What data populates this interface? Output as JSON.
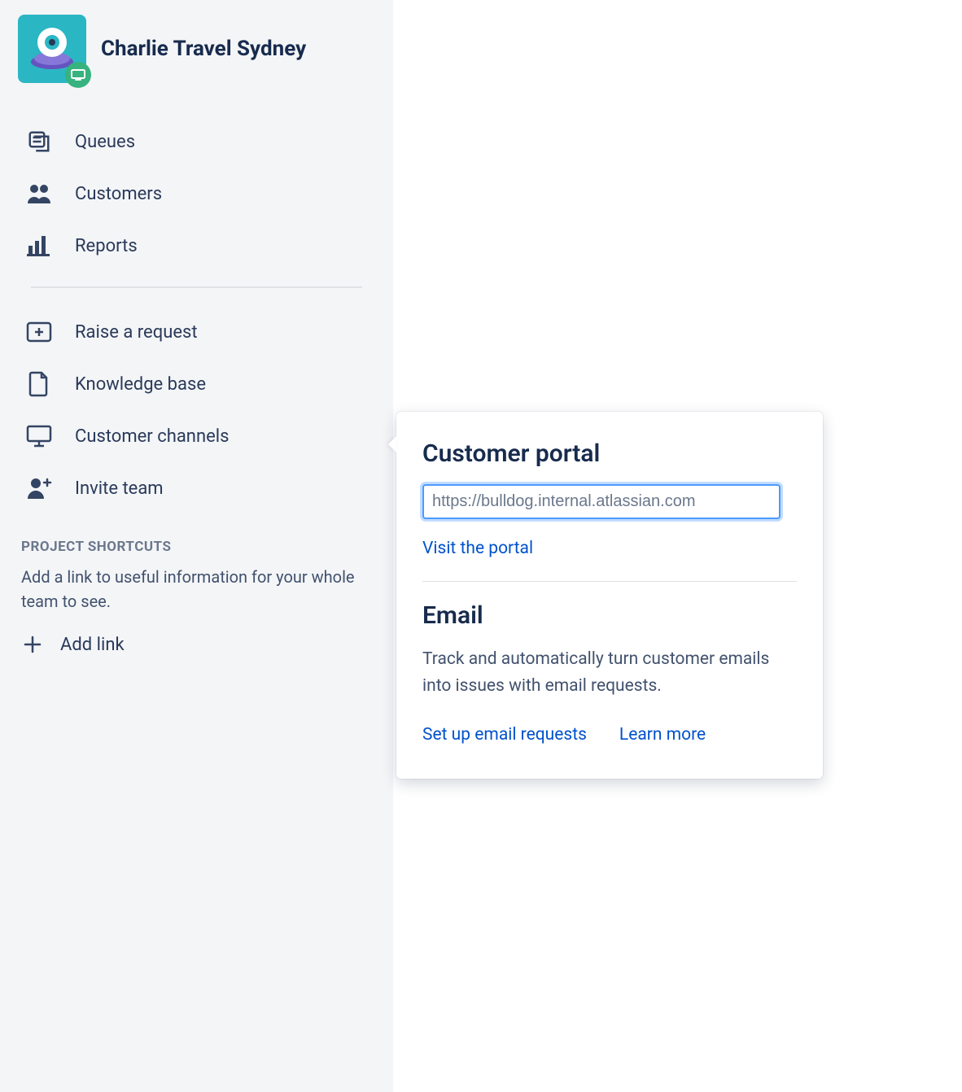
{
  "project": {
    "title": "Charlie Travel Sydney"
  },
  "nav": {
    "queues": "Queues",
    "customers": "Customers",
    "reports": "Reports",
    "raise_request": "Raise a request",
    "knowledge_base": "Knowledge base",
    "customer_channels": "Customer channels",
    "invite_team": "Invite team"
  },
  "shortcuts": {
    "heading": "PROJECT SHORTCUTS",
    "description": "Add a link to useful information for your whole team to see.",
    "add_link_label": "Add link"
  },
  "popover": {
    "portal_heading": "Customer portal",
    "portal_url": "https://bulldog.internal.atlassian.com",
    "visit_portal": "Visit the portal",
    "email_heading": "Email",
    "email_description": "Track and automatically turn customer emails into issues with email requests.",
    "setup_email": "Set up email requests",
    "learn_more": "Learn more"
  }
}
